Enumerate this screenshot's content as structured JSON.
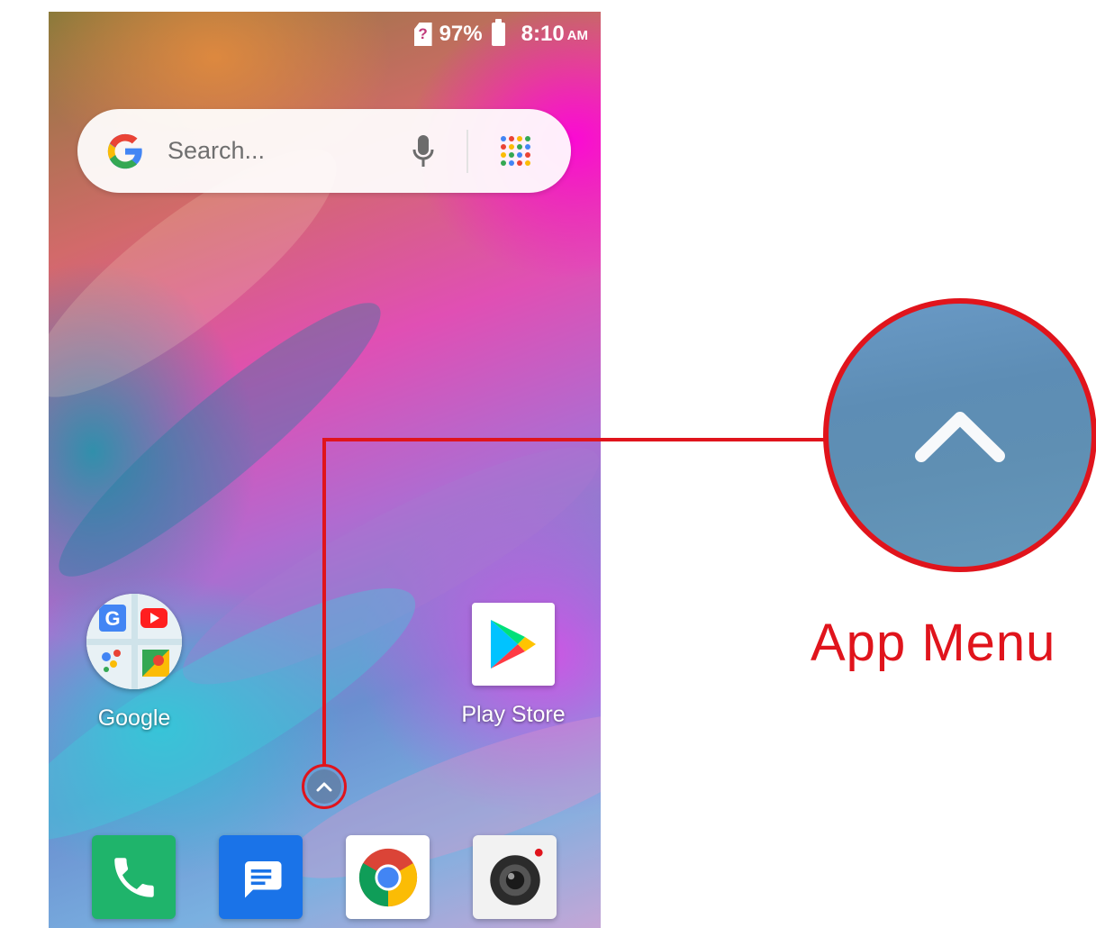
{
  "status_bar": {
    "sim_glyph": "?",
    "battery_percent": "97%",
    "time": "8:10",
    "ampm": "AM"
  },
  "search": {
    "placeholder": "Search..."
  },
  "home_apps": [
    {
      "label": "Google"
    },
    {
      "label": "Play Store"
    }
  ],
  "dock_apps": [
    {
      "icon": "phone-icon"
    },
    {
      "icon": "messages-icon"
    },
    {
      "icon": "chrome-icon"
    },
    {
      "icon": "camera-icon"
    }
  ],
  "app_drawer": {
    "icon": "chevron-up-icon"
  },
  "callout": {
    "label": "App Menu",
    "color": "#e0141c"
  }
}
